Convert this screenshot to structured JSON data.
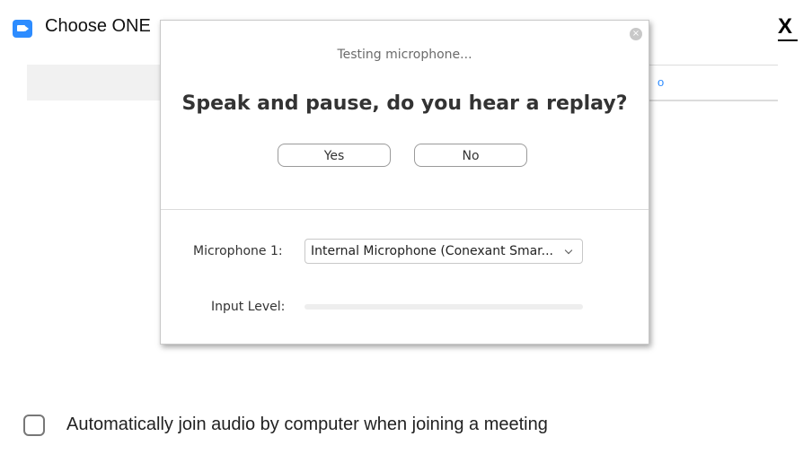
{
  "window": {
    "title": "Choose ONE",
    "close_glyph": "X",
    "link_text": "o"
  },
  "dialog": {
    "close_glyph": "×",
    "status": "Testing microphone...",
    "question": "Speak and pause, do you hear a replay?",
    "yes_label": "Yes",
    "no_label": "No",
    "microphone_label": "Microphone 1:",
    "microphone_value": "Internal Microphone (Conexant Smar...",
    "input_level_label": "Input Level:",
    "input_level": 0
  },
  "auto_join": {
    "label": "Automatically join audio by computer when joining a meeting",
    "checked": false
  },
  "colors": {
    "accent": "#2d8cff"
  }
}
